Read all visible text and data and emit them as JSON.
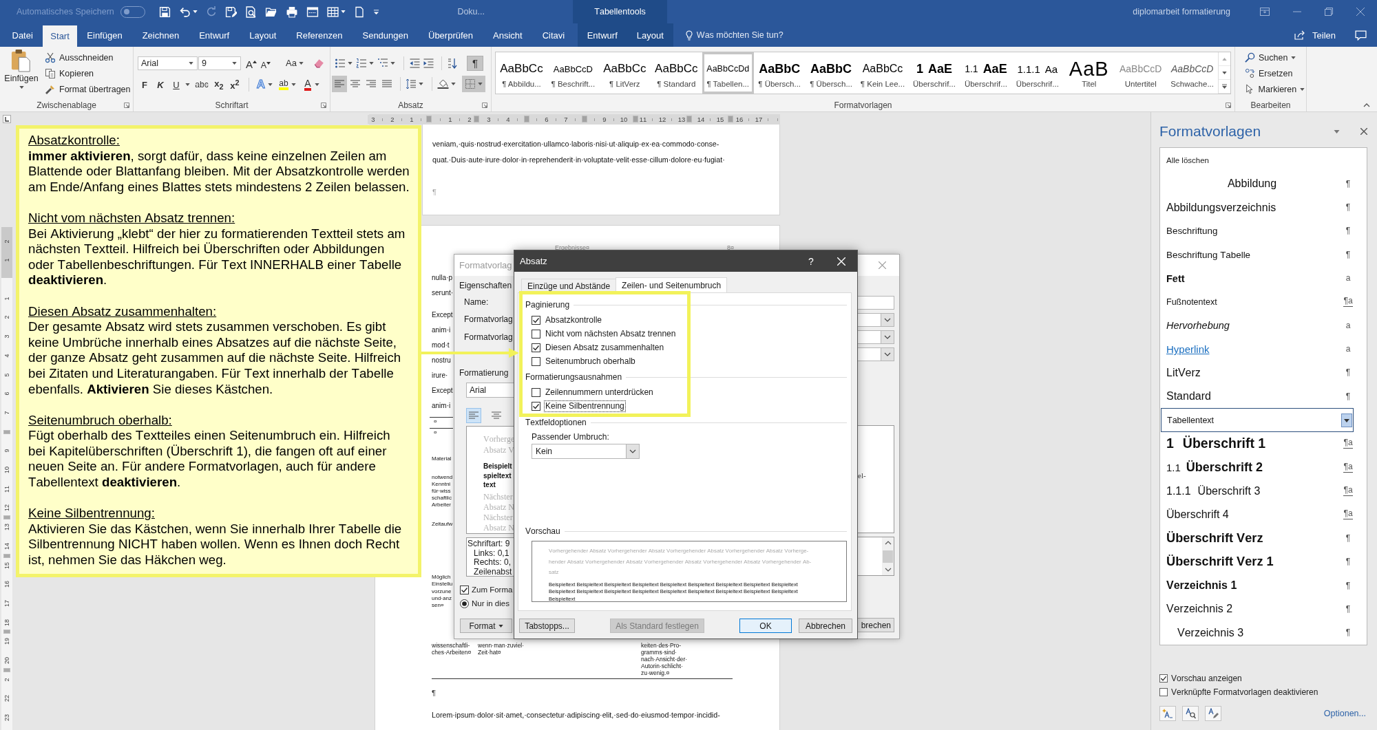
{
  "title_bar": {
    "autosave_label": "Automatisches Speichern",
    "autosave_on": false,
    "document_title": "Doku...",
    "context_label": "Tabellentools",
    "file_title": "diplomarbeit formatierung"
  },
  "menu_tabs": [
    {
      "label": "Datei",
      "selected": false,
      "contextual": false
    },
    {
      "label": "Start",
      "selected": true,
      "contextual": false
    },
    {
      "label": "Einfügen",
      "selected": false,
      "contextual": false
    },
    {
      "label": "Zeichnen",
      "selected": false,
      "contextual": false
    },
    {
      "label": "Entwurf",
      "selected": false,
      "contextual": false
    },
    {
      "label": "Layout",
      "selected": false,
      "contextual": false
    },
    {
      "label": "Referenzen",
      "selected": false,
      "contextual": false
    },
    {
      "label": "Sendungen",
      "selected": false,
      "contextual": false
    },
    {
      "label": "Überprüfen",
      "selected": false,
      "contextual": false
    },
    {
      "label": "Ansicht",
      "selected": false,
      "contextual": false
    },
    {
      "label": "Citavi",
      "selected": false,
      "contextual": false
    },
    {
      "label": "Entwurf",
      "selected": false,
      "contextual": true
    },
    {
      "label": "Layout",
      "selected": false,
      "contextual": true
    }
  ],
  "tell_me": {
    "placeholder": "Was möchten Sie tun?"
  },
  "share": {
    "label": "Teilen"
  },
  "clipboard": {
    "paste_label": "Einfügen",
    "commands": [
      "Ausschneiden",
      "Kopieren",
      "Format übertragen"
    ],
    "group_label": "Zwischenablage"
  },
  "font_group": {
    "font_name": "Arial",
    "font_size": "9",
    "grow_glyph": "A",
    "shrink_glyph": "A",
    "case_glyph": "Aa",
    "format_glyphs": [
      "F",
      "K",
      "U",
      "abc",
      "x$_{2}$",
      "x$^{2}$"
    ],
    "effects_glyph": "A",
    "highlight_glyph": "ab",
    "color_glyph": "A",
    "group_label": "Schriftart"
  },
  "paragraph_group": {
    "marks_glyph": "¶",
    "marks_on": true,
    "alignments": [
      {
        "kind": "left",
        "selected": true
      },
      {
        "kind": "center",
        "selected": false
      },
      {
        "kind": "right",
        "selected": false
      },
      {
        "kind": "justify",
        "selected": false
      }
    ],
    "borders_on": true,
    "group_label": "Absatz"
  },
  "styles_gallery": {
    "items": [
      {
        "preview": "AaBbCc",
        "name": "¶ Abbildu...",
        "selected": false
      },
      {
        "preview": "AaBbCcD",
        "name": "¶ Beschrift...",
        "selected": false
      },
      {
        "preview": "AaBbCc",
        "name": "¶ LitVerz",
        "selected": false
      },
      {
        "preview": "AaBbCc",
        "name": "¶ Standard",
        "selected": false
      },
      {
        "preview": "AaBbCcDd",
        "name": "¶ Tabellen...",
        "selected": true
      },
      {
        "preview": "AaBbC",
        "name": "¶ Übersch...",
        "selected": false
      },
      {
        "preview": "AaBbC",
        "name": "¶ Übersch...",
        "selected": false
      },
      {
        "preview": "AaBbCc",
        "name": "¶ Kein Lee...",
        "selected": false
      },
      {
        "number": "1",
        "preview": "AaE",
        "name": "Überschrif...",
        "selected": false
      },
      {
        "number": "1.1",
        "preview": "AaE",
        "name": "Überschrif...",
        "selected": false
      },
      {
        "number": "1.1.1",
        "preview": "Aa",
        "name": "Überschrif...",
        "selected": false
      },
      {
        "preview": "AaB",
        "name": "Titel",
        "selected": false
      },
      {
        "preview": "AaBbCcD",
        "name": "Untertitel",
        "selected": false
      },
      {
        "preview": "AaBbCcD",
        "name": "Schwache...",
        "selected": false
      }
    ],
    "group_label": "Formatvorlagen"
  },
  "editing": {
    "commands": [
      {
        "label": "Suchen",
        "dropdown": true
      },
      {
        "label": "Ersetzen",
        "dropdown": false
      },
      {
        "label": "Markieren",
        "dropdown": true
      }
    ],
    "group_label": "Bearbeiten"
  },
  "rulers": {
    "horizontal": [
      "3",
      "2",
      "1",
      "1",
      "2",
      "3",
      "4",
      "6",
      "7",
      "9",
      "10",
      "11",
      "12",
      "13",
      "14",
      "15",
      "16",
      "17"
    ],
    "vertical": [
      "2",
      "1",
      "1",
      "2",
      "3",
      "4",
      "5",
      "6",
      "7",
      "9",
      "10",
      "11",
      "12",
      "13",
      "14",
      "15",
      "16",
      "17",
      "18",
      "19",
      "20",
      "2",
      "22",
      "23"
    ]
  },
  "annotation": {
    "sections": [
      {
        "heading": "Absatzkontrolle:",
        "body": "**immer aktivieren**, sorgt dafür, dass keine einzelnen Zeilen am Blattende oder Blattanfang bleiben. Mit der Absatzkontrolle werden am Ende/Anfang eines Blattes stets mindestens 2 Zeilen belassen."
      },
      {
        "heading": "Nicht vom nächsten Absatz trennen:",
        "body": "Bei Aktivierung „klebt“ der hier zu formatierenden Textteil stets am nächsten Textteil. Hilfreich bei Überschriften oder Abbildungen oder Tabellenbeschriftungen. Für Text INNERHALB einer Tabelle **deaktivieren**."
      },
      {
        "heading": "Diesen Absatz zusammenhalten:",
        "body": "Der gesamte Absatz wird stets zusammen verschoben. Es gibt keine Umbrüche innerhalb eines Absatzes auf die nächste Seite, der ganze Absatz geht zusammen auf die nächste Seite. Hilfreich bei Zitaten und Literaturangaben. Für Text innerhalb der Tabelle ebenfalls. **Aktivieren** Sie dieses Kästchen."
      },
      {
        "heading": "Seitenumbruch oberhalb:",
        "body": "Fügt oberhalb des Textteiles einen Seitenumbruch ein. Hilfreich bei Kapitelüberschriften (Überschrift 1), die fangen oft auf einer neuen Seite an. Für andere Formatvorlagen, auch für andere Tabellentext **deaktivieren**."
      },
      {
        "heading": "Keine Silbentrennung:",
        "body": "Aktivieren Sie das Kästchen, wenn Sie innerhalb Ihrer Tabelle die Silbentrennung NICHT haben wollen. Wenn es Ihnen doch Recht ist, nehmen Sie das Häkchen weg."
      }
    ]
  },
  "document": {
    "page1_lines": [
      "veniam,·quis·nostrud·exercitation·ullamco·laboris·nisi·ut·aliquip·ex·ea·commodo·conse-",
      "quat.·Duis·aute·irure·dolor·in·reprehenderit·in·voluptate·velit·esse·cillum·dolore·eu·fugiat·"
    ],
    "page1_mark": "¶",
    "header_cells": [
      "Ergebnisse¤",
      "8¤"
    ],
    "side_fragments": [
      [
        "nulla·p",
        "serunt·"
      ],
      [
        "Except",
        "anim·i",
        "mod·t",
        "nostru",
        "irure·",
        "Except",
        "anim·i"
      ],
      [
        "¤"
      ],
      [
        "¤"
      ],
      [
        "Material"
      ],
      [
        "notwend",
        "Kenntni",
        "für·wiss",
        "schaftlic",
        "Arbeiter"
      ],
      [
        "Zeitaufw"
      ],
      [
        "Möglich",
        "Einstellu",
        "vorzune",
        "und·anz",
        "sen¤"
      ]
    ],
    "table_cells": [
      [
        "wissenschaftli-",
        "ches·Arbeiten¤"
      ],
      [
        "wenn·man·zuviel·",
        "Zeit·hat¤"
      ],
      [
        "keiten·des·Pro-",
        "gramms·sind·",
        "nach·Ansicht·der·",
        "Autorin·schlicht·",
        "zu·wenig.¤"
      ]
    ],
    "end_mark": "¶",
    "body_line": "Lorem·ipsum·dolor·sit·amet,·consectetur·adipiscing·elit,·sed·do·eiusmod·tempor·incidid-"
  },
  "style_dialog": {
    "title": "Formatvorlag",
    "properties_label": "Eigenschaften",
    "field_labels": [
      "Name:",
      "Formatvorlag",
      "Formatvorlag"
    ],
    "formatting_label": "Formatierung",
    "font_name": "Arial",
    "alignments": [
      {
        "kind": "left",
        "selected": true
      },
      {
        "kind": "center",
        "selected": false
      }
    ],
    "preview_paragraphs": [
      {
        "kind": "previous",
        "lines": [
          "Vorherge",
          "Absatz V"
        ]
      },
      {
        "kind": "sample",
        "lines": [
          "Beispielt",
          "spieltext",
          "text"
        ]
      },
      {
        "kind": "following",
        "lines": [
          "Nächster",
          "Absatz N",
          "Nächster",
          "Absatz N"
        ]
      }
    ],
    "preview_right": "el-",
    "description": [
      "Schriftart: 9",
      "Links: 0,1",
      "Rechts: 0,",
      "Zeilenabst"
    ],
    "add_to_gallery": {
      "label": "Zum Forma",
      "checked": true
    },
    "scope": {
      "label": "Nur in dies",
      "selected": true
    },
    "format_button": "Format",
    "cancel_button": "brechen"
  },
  "paragraph_dialog": {
    "title": "Absatz",
    "help_glyph": "?",
    "tabs": [
      {
        "label": "Einzüge und Abstände",
        "selected": false
      },
      {
        "label": "Zeilen- und Seitenumbruch",
        "selected": true
      }
    ],
    "sections": [
      {
        "heading": "Paginierung",
        "options": [
          {
            "label": "Absatzkontrolle",
            "checked": true,
            "focused": false
          },
          {
            "label": "Nicht vom nächsten Absatz trennen",
            "checked": false,
            "focused": false
          },
          {
            "label": "Diesen Absatz zusammenhalten",
            "checked": true,
            "focused": false
          },
          {
            "label": "Seitenumbruch oberhalb",
            "checked": false,
            "focused": false
          }
        ]
      },
      {
        "heading": "Formatierungsausnahmen",
        "options": [
          {
            "label": "Zeilennummern unterdrücken",
            "checked": false,
            "focused": false
          },
          {
            "label": "Keine Silbentrennung",
            "checked": true,
            "focused": true
          }
        ]
      }
    ],
    "textbox_heading": "Textfeldoptionen",
    "wrap_label": "Passender Umbruch:",
    "wrap_value": "Kein",
    "preview_heading": "Vorschau",
    "preview_previous": [
      "Vorhergehender Absatz Vorhergehender Absatz Vorhergehender Absatz Vorhergehender Absatz Vorherge-",
      "hender Absatz Vorhergehender Absatz Vorhergehender Absatz Vorhergehender Absatz Vorhergehender Ab-",
      "satz"
    ],
    "preview_sample": [
      "Beispieltext Beispieltext Beispieltext Beispieltext Beispieltext Beispieltext Beispieltext Beispieltext Beispieltext",
      "Beispieltext Beispieltext Beispieltext Beispieltext Beispieltext Beispieltext Beispieltext Beispieltext Beispieltext",
      "Beispieltext"
    ],
    "buttons": [
      {
        "label": "Tabstopps...",
        "disabled": false,
        "default": false
      },
      {
        "label": "Als Standard festlegen",
        "disabled": true,
        "default": false
      },
      {
        "label": "OK",
        "disabled": false,
        "default": true
      },
      {
        "label": "Abbrechen",
        "disabled": false,
        "default": false
      }
    ]
  },
  "styles_pane": {
    "title": "Formatvorlagen",
    "clear_all": "Alle löschen",
    "items": [
      {
        "name": "Abbildung",
        "symbol": "¶",
        "linked": false,
        "selected": false
      },
      {
        "name": "Abbildungsverzeichnis",
        "symbol": "¶",
        "linked": false,
        "selected": false
      },
      {
        "name": "Beschriftung",
        "symbol": "¶",
        "linked": false,
        "selected": false
      },
      {
        "name": "Beschriftung Tabelle",
        "symbol": "¶",
        "linked": false,
        "selected": false
      },
      {
        "name": "Fett",
        "symbol": "a",
        "linked": false,
        "selected": false
      },
      {
        "name": "Fußnotentext",
        "symbol": "¶a",
        "linked": true,
        "selected": false
      },
      {
        "name": "Hervorhebung",
        "symbol": "a",
        "linked": false,
        "selected": false
      },
      {
        "name": "Hyperlink",
        "symbol": "a",
        "linked": false,
        "selected": false
      },
      {
        "name": "LitVerz",
        "symbol": "¶",
        "linked": false,
        "selected": false
      },
      {
        "name": "Standard",
        "symbol": "¶",
        "linked": false,
        "selected": false
      },
      {
        "name": "Tabellentext",
        "selected": true
      },
      {
        "number": "1",
        "name": "Überschrift 1",
        "symbol": "¶a",
        "linked": true,
        "selected": false
      },
      {
        "number": "1.1",
        "name": "Überschrift 2",
        "symbol": "¶a",
        "linked": true,
        "selected": false
      },
      {
        "number": "1.1.1",
        "name": "Überschrift 3",
        "symbol": "¶a",
        "linked": true,
        "selected": false
      },
      {
        "name": "Überschrift 4",
        "symbol": "¶a",
        "linked": true,
        "selected": false
      },
      {
        "name": "Überschrift Verz",
        "symbol": "¶",
        "linked": false,
        "selected": false
      },
      {
        "name": "Überschrift Verz 1",
        "symbol": "¶",
        "linked": false,
        "selected": false
      },
      {
        "name": "Verzeichnis 1",
        "symbol": "¶",
        "linked": false,
        "selected": false
      },
      {
        "name": "Verzeichnis 2",
        "symbol": "¶",
        "linked": false,
        "selected": false
      },
      {
        "name": "Verzeichnis 3",
        "symbol": "¶",
        "linked": false,
        "selected": false
      }
    ],
    "show_preview": {
      "label": "Vorschau anzeigen",
      "checked": true
    },
    "disable_linked": {
      "label": "Verknüpfte Formatvorlagen deaktivieren",
      "checked": false
    },
    "options_link": "Optionen..."
  }
}
